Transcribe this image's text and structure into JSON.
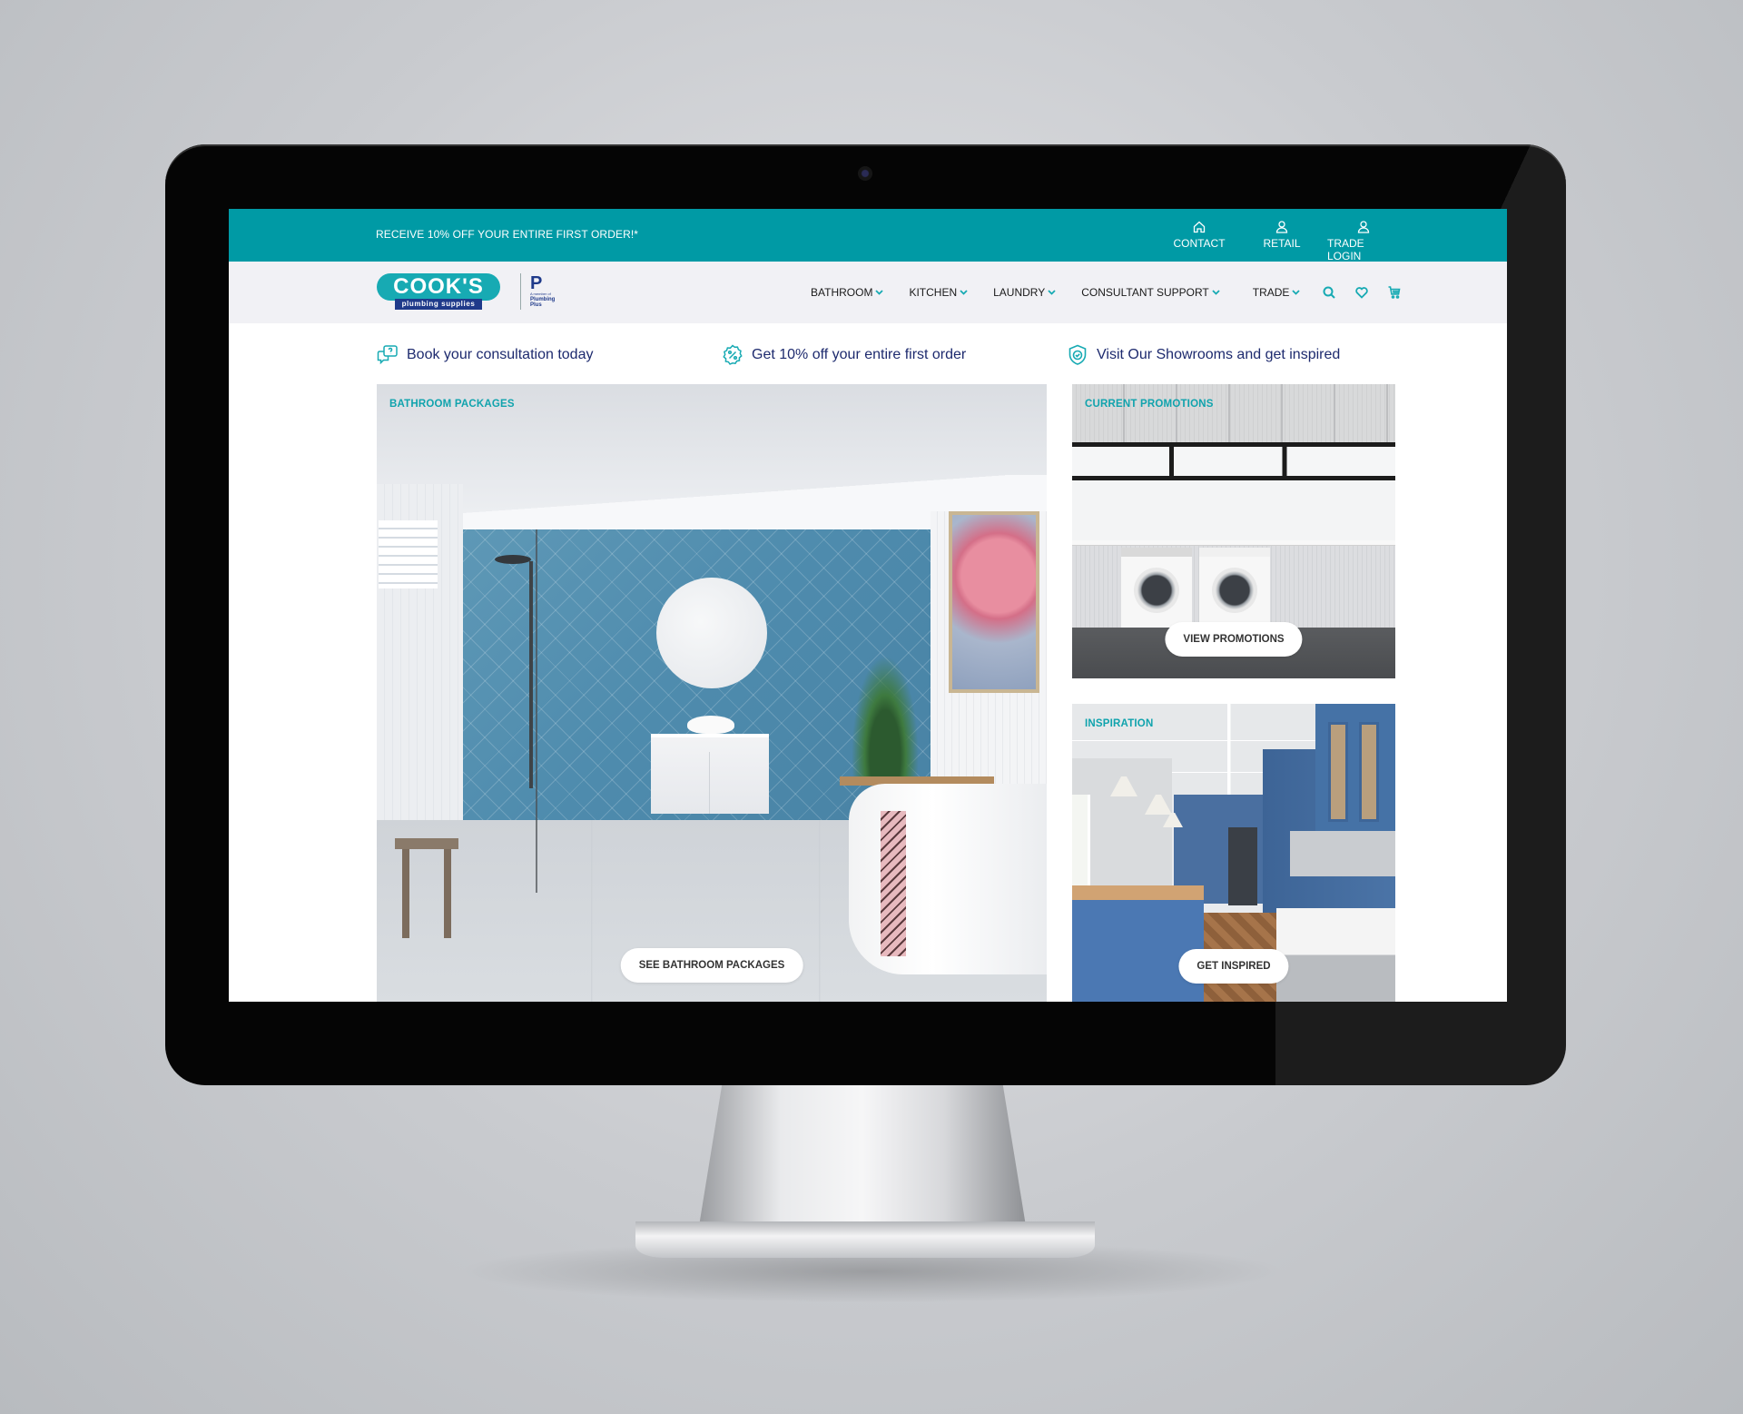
{
  "promo_bar": {
    "text": "RECEIVE 10% OFF YOUR ENTIRE FIRST ORDER!*",
    "links": [
      {
        "label": "CONTACT",
        "icon": "home-icon"
      },
      {
        "label": "RETAIL",
        "icon": "user-icon"
      },
      {
        "label": "TRADE LOGIN",
        "icon": "user-icon"
      }
    ]
  },
  "header": {
    "logo": {
      "brand": "COOK'S",
      "tagline": "plumbing supplies",
      "partner_mark": "P",
      "partner_text_1": "A member of",
      "partner_text_2": "Plumbing",
      "partner_text_3": "Plus"
    },
    "nav": [
      {
        "label": "BATHROOM",
        "has_dropdown": true
      },
      {
        "label": "KITCHEN",
        "has_dropdown": true
      },
      {
        "label": "LAUNDRY",
        "has_dropdown": true
      },
      {
        "label": "CONSULTANT SUPPORT",
        "has_dropdown": true
      },
      {
        "label": "TRADE",
        "has_dropdown": true
      }
    ],
    "icons": [
      "search-icon",
      "heart-icon",
      "cart-icon"
    ]
  },
  "usps": [
    {
      "text": "Book your consultation today",
      "icon": "chat-question-icon"
    },
    {
      "text": "Get 10% off your entire first order",
      "icon": "percent-badge-icon"
    },
    {
      "text": "Visit Our Showrooms and get inspired",
      "icon": "shield-check-icon"
    }
  ],
  "tiles": {
    "bathroom": {
      "label": "BATHROOM PACKAGES",
      "button": "SEE BATHROOM PACKAGES"
    },
    "promotions": {
      "label": "CURRENT PROMOTIONS",
      "button": "VIEW PROMOTIONS"
    },
    "inspiration": {
      "label": "INSPIRATION",
      "button": "GET INSPIRED"
    }
  },
  "colors": {
    "teal": "#009aa5",
    "accent_teal": "#17aab3",
    "navy": "#1d2a6e",
    "header_bg": "#f1f1f5"
  }
}
